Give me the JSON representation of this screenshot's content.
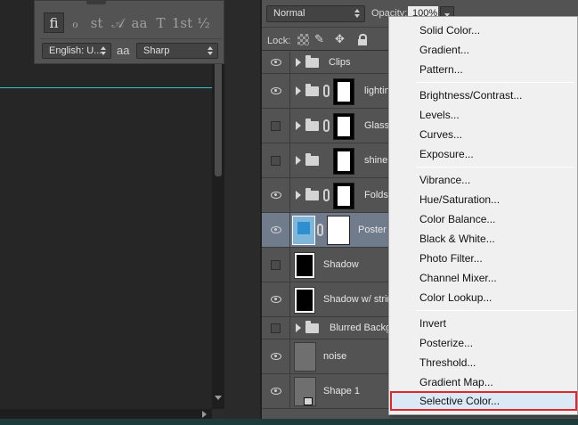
{
  "character_panel": {
    "glyphs": [
      "fi",
      "ℴ",
      "st",
      "𝒜",
      "aa",
      "T",
      "1st",
      "½"
    ],
    "language": "English: U...",
    "aa_icon": "aa",
    "antialias": "Sharp"
  },
  "layers_panel": {
    "blend_mode": "Normal",
    "opacity_label": "Opacity:",
    "opacity_value": "100%",
    "lock_label": "Lock:",
    "layers": [
      {
        "name": "Clips",
        "visible": true,
        "type": "group"
      },
      {
        "name": "lightin",
        "visible": true,
        "type": "group-masked"
      },
      {
        "name": "Glass",
        "visible": false,
        "type": "group-masked"
      },
      {
        "name": "shine",
        "visible": false,
        "type": "group-masked"
      },
      {
        "name": "Folds",
        "visible": true,
        "type": "group-masked"
      },
      {
        "name": "Poster",
        "visible": true,
        "type": "smart-masked",
        "selected": true
      },
      {
        "name": "Shadow",
        "visible": false,
        "type": "pixel"
      },
      {
        "name": "Shadow w/ strin",
        "visible": true,
        "type": "pixel"
      },
      {
        "name": "Blurred Backgr",
        "visible": false,
        "type": "group"
      },
      {
        "name": "noise",
        "visible": true,
        "type": "pixel-grey"
      },
      {
        "name": "Shape 1",
        "visible": true,
        "type": "shape"
      }
    ]
  },
  "adjustment_menu": {
    "items": [
      {
        "label": "Solid Color..."
      },
      {
        "label": "Gradient..."
      },
      {
        "label": "Pattern..."
      },
      {
        "label": "Brightness/Contrast..."
      },
      {
        "label": "Levels..."
      },
      {
        "label": "Curves..."
      },
      {
        "label": "Exposure..."
      },
      {
        "label": "Vibrance..."
      },
      {
        "label": "Hue/Saturation..."
      },
      {
        "label": "Color Balance..."
      },
      {
        "label": "Black & White..."
      },
      {
        "label": "Photo Filter..."
      },
      {
        "label": "Channel Mixer..."
      },
      {
        "label": "Color Lookup..."
      },
      {
        "label": "Invert"
      },
      {
        "label": "Posterize..."
      },
      {
        "label": "Threshold..."
      },
      {
        "label": "Gradient Map..."
      },
      {
        "label": "Selective Color...",
        "highlighted": true
      }
    ]
  },
  "colors": {
    "guide": "#35c6c8",
    "highlight_border": "#e3262b",
    "selected_layer": "#707b8c"
  }
}
